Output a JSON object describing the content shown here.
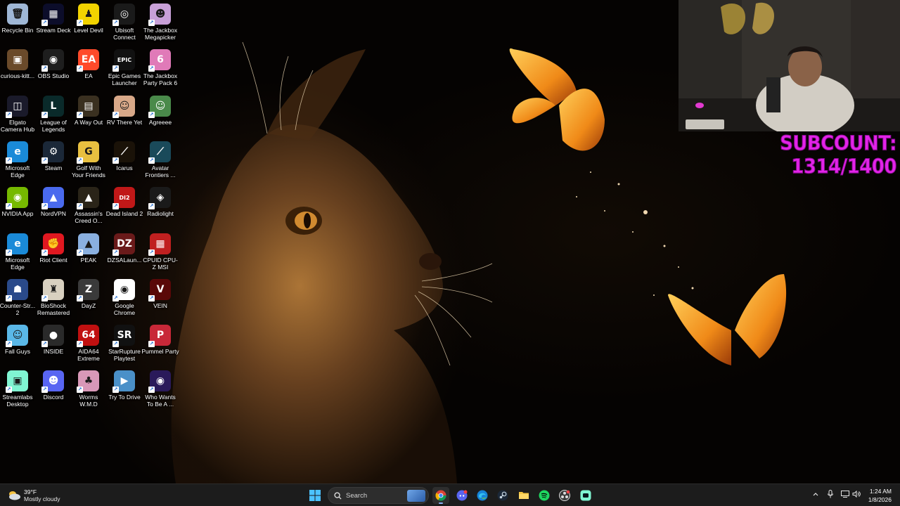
{
  "desktop": {
    "icons": [
      {
        "label": "Recycle Bin",
        "icon": "recycle-bin-icon",
        "color": "#9fb7d6",
        "glyph": "🗑",
        "shortcut": false
      },
      {
        "label": "Stream Deck",
        "icon": "stream-deck-icon",
        "color": "#0c0d2a",
        "glyph": "▦",
        "shortcut": true
      },
      {
        "label": "Level Devil",
        "icon": "level-devil-icon",
        "color": "#f2d300",
        "glyph": "♟",
        "shortcut": true
      },
      {
        "label": "Ubisoft Connect",
        "icon": "ubisoft-icon",
        "color": "#1a1a1a",
        "glyph": "◎",
        "shortcut": true
      },
      {
        "label": "The Jackbox Megapicker",
        "icon": "jackbox-megapicker-icon",
        "color": "#c8a0d8",
        "glyph": "☻",
        "shortcut": true
      },
      {
        "label": "curious-kitt...",
        "icon": "image-file-icon",
        "color": "#6a4a2a",
        "glyph": "▣",
        "shortcut": false
      },
      {
        "label": "OBS Studio",
        "icon": "obs-icon",
        "color": "#1e1e1e",
        "glyph": "◉",
        "shortcut": true
      },
      {
        "label": "EA",
        "icon": "ea-icon",
        "color": "#ff4a2a",
        "glyph": "EA",
        "shortcut": true
      },
      {
        "label": "Epic Games Launcher",
        "icon": "epic-games-icon",
        "color": "#111111",
        "glyph": "EPIC",
        "shortcut": true
      },
      {
        "label": "The Jackbox Party Pack 6",
        "icon": "jackbox-pack6-icon",
        "color": "#e07ab8",
        "glyph": "6",
        "shortcut": true
      },
      {
        "label": "Elgato Camera Hub",
        "icon": "elgato-icon",
        "color": "#1a1a2a",
        "glyph": "◫",
        "shortcut": true
      },
      {
        "label": "League of Legends",
        "icon": "league-icon",
        "color": "#0a2a2a",
        "glyph": "L",
        "shortcut": true
      },
      {
        "label": "A Way Out",
        "icon": "a-way-out-icon",
        "color": "#3a3020",
        "glyph": "▤",
        "shortcut": true
      },
      {
        "label": "RV There Yet",
        "icon": "rv-there-yet-icon",
        "color": "#d8a888",
        "glyph": "☺",
        "shortcut": true
      },
      {
        "label": "Agreeee",
        "icon": "agreeee-icon",
        "color": "#4a8a4a",
        "glyph": "☺",
        "shortcut": true
      },
      {
        "label": "Microsoft Edge",
        "icon": "edge-icon",
        "color": "#1a8ad8",
        "glyph": "e",
        "shortcut": true
      },
      {
        "label": "Steam",
        "icon": "steam-icon",
        "color": "#1b2838",
        "glyph": "⚙",
        "shortcut": true
      },
      {
        "label": "Golf With Your Friends",
        "icon": "golf-icon",
        "color": "#e8c040",
        "glyph": "G",
        "shortcut": true
      },
      {
        "label": "Icarus",
        "icon": "icarus-icon",
        "color": "#1a1208",
        "glyph": "⟋",
        "shortcut": true
      },
      {
        "label": "Avatar Frontiers ...",
        "icon": "avatar-icon",
        "color": "#1a4a5a",
        "glyph": "⟋",
        "shortcut": true
      },
      {
        "label": "NVIDIA App",
        "icon": "nvidia-icon",
        "color": "#76b900",
        "glyph": "◉",
        "shortcut": true
      },
      {
        "label": "NordVPN",
        "icon": "nordvpn-icon",
        "color": "#4a6aee",
        "glyph": "▲",
        "shortcut": true
      },
      {
        "label": "Assassin's Creed O...",
        "icon": "assassins-creed-icon",
        "color": "#2a2418",
        "glyph": "▲",
        "shortcut": true
      },
      {
        "label": "Dead Island 2",
        "icon": "dead-island-icon",
        "color": "#c01818",
        "glyph": "DI2",
        "shortcut": true
      },
      {
        "label": "Radiolight",
        "icon": "radiolight-icon",
        "color": "#1a1a1a",
        "glyph": "◈",
        "shortcut": true
      },
      {
        "label": "Microsoft Edge",
        "icon": "edge-icon",
        "color": "#1a8ad8",
        "glyph": "e",
        "shortcut": true
      },
      {
        "label": "Riot Client",
        "icon": "riot-icon",
        "color": "#e01820",
        "glyph": "✊",
        "shortcut": true
      },
      {
        "label": "PEAK",
        "icon": "peak-icon",
        "color": "#8ab0e0",
        "glyph": "▲",
        "shortcut": true
      },
      {
        "label": "DZSALaun...",
        "icon": "dzsa-icon",
        "color": "#6a1a1a",
        "glyph": "DZ",
        "shortcut": true
      },
      {
        "label": "CPUID CPU-Z MSI",
        "icon": "cpuz-icon",
        "color": "#c02020",
        "glyph": "▦",
        "shortcut": true
      },
      {
        "label": "Counter-Str... 2",
        "icon": "counter-strike-icon",
        "color": "#2a4a8a",
        "glyph": "☗",
        "shortcut": true
      },
      {
        "label": "BioShock Remastered",
        "icon": "bioshock-icon",
        "color": "#d8d0c0",
        "glyph": "♜",
        "shortcut": true
      },
      {
        "label": "DayZ",
        "icon": "dayz-icon",
        "color": "#3a3a3a",
        "glyph": "Z",
        "shortcut": true
      },
      {
        "label": "Google Chrome",
        "icon": "chrome-icon",
        "color": "#ffffff",
        "glyph": "◉",
        "shortcut": true
      },
      {
        "label": "VEIN",
        "icon": "vein-icon",
        "color": "#5a0808",
        "glyph": "V",
        "shortcut": true
      },
      {
        "label": "Fall Guys",
        "icon": "fall-guys-icon",
        "color": "#5ab8e8",
        "glyph": "☺",
        "shortcut": true
      },
      {
        "label": "INSIDE",
        "icon": "inside-icon",
        "color": "#2a2a2a",
        "glyph": "●",
        "shortcut": true
      },
      {
        "label": "AIDA64 Extreme",
        "icon": "aida64-icon",
        "color": "#c01010",
        "glyph": "64",
        "shortcut": true
      },
      {
        "label": "StarRupture Playtest",
        "icon": "starrupture-icon",
        "color": "#111111",
        "glyph": "SR",
        "shortcut": true
      },
      {
        "label": "Pummel Party",
        "icon": "pummel-party-icon",
        "color": "#c82838",
        "glyph": "P",
        "shortcut": true
      },
      {
        "label": "Streamlabs Desktop",
        "icon": "streamlabs-icon",
        "color": "#80f5d2",
        "glyph": "▣",
        "shortcut": true
      },
      {
        "label": "Discord",
        "icon": "discord-icon",
        "color": "#5865f2",
        "glyph": "☻",
        "shortcut": true
      },
      {
        "label": "Worms W.M.D",
        "icon": "worms-icon",
        "color": "#d898b8",
        "glyph": "♣",
        "shortcut": true
      },
      {
        "label": "Try To Drive",
        "icon": "try-to-drive-icon",
        "color": "#4a90c8",
        "glyph": "▶",
        "shortcut": true
      },
      {
        "label": "Who Wants To Be A ...",
        "icon": "millionaire-icon",
        "color": "#2a1a5a",
        "glyph": "◉",
        "shortcut": true
      }
    ]
  },
  "overlay": {
    "subcount": "SUBCOUNT: 1314/1400",
    "subcount_color": "#e224e8"
  },
  "taskbar": {
    "weather": {
      "temp": "39°F",
      "condition": "Mostly cloudy",
      "icon": "cloud-icon"
    },
    "search_label": "Search",
    "apps": [
      {
        "name": "start-button",
        "icon": "windows-icon"
      },
      {
        "name": "taskbar-chrome",
        "icon": "chrome-icon"
      },
      {
        "name": "taskbar-discord",
        "icon": "discord-icon"
      },
      {
        "name": "taskbar-edge",
        "icon": "edge-icon"
      },
      {
        "name": "taskbar-steam",
        "icon": "steam-icon"
      },
      {
        "name": "taskbar-file-explorer",
        "icon": "folder-icon"
      },
      {
        "name": "taskbar-spotify",
        "icon": "spotify-icon"
      },
      {
        "name": "taskbar-obs",
        "icon": "obs-icon"
      },
      {
        "name": "taskbar-streamlabs",
        "icon": "streamlabs-icon"
      }
    ],
    "clock": {
      "time": "1:24 AM",
      "date": "1/8/2026"
    },
    "accent": "#8ab4f8"
  }
}
